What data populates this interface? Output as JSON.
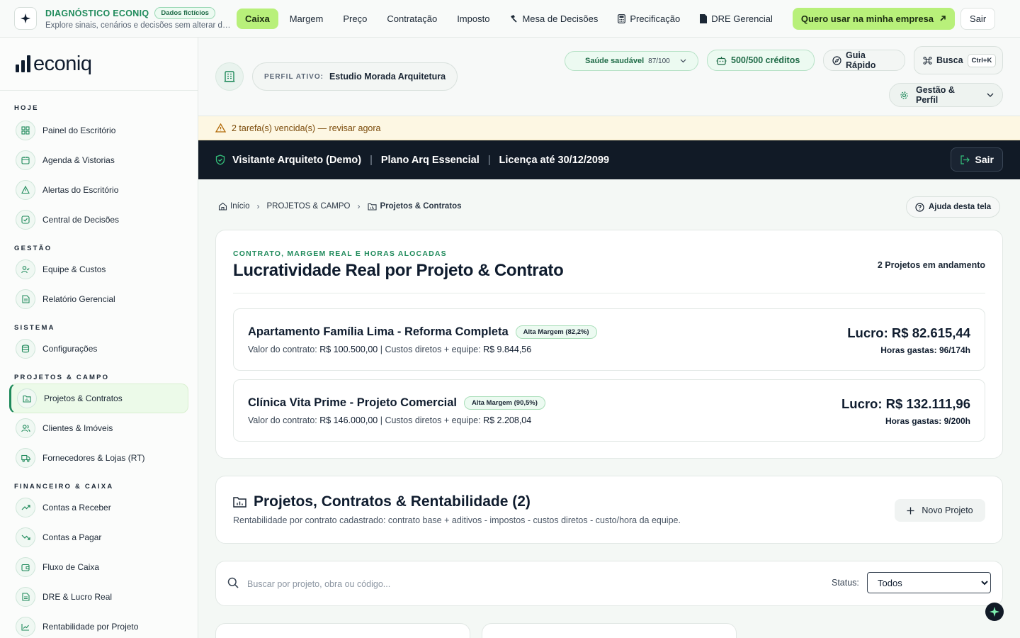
{
  "topbar": {
    "title": "DIAGNÓSTICO ECONIQ",
    "badge": "Dados fictícios",
    "subtitle": "Explore sinais, cenários e decisões sem alterar da...",
    "nav": [
      {
        "label": "Caixa",
        "active": true
      },
      {
        "label": "Margem"
      },
      {
        "label": "Preço"
      },
      {
        "label": "Contratação"
      },
      {
        "label": "Imposto"
      },
      {
        "label": "Mesa de Decisões",
        "icon": "gavel-icon"
      },
      {
        "label": "Precificação",
        "icon": "calculator-icon"
      },
      {
        "label": "DRE Gerencial",
        "icon": "file-icon"
      }
    ],
    "cta": "Quero usar na minha empresa",
    "exit": "Sair"
  },
  "sidebar": {
    "brand": "econiq",
    "sections": [
      {
        "title": "HOJE",
        "items": [
          "Painel do Escritório",
          "Agenda & Vistorias",
          "Alertas do Escritório",
          "Central de Decisões"
        ]
      },
      {
        "title": "GESTÃO",
        "items": [
          "Equipe & Custos",
          "Relatório Gerencial"
        ]
      },
      {
        "title": "SISTEMA",
        "items": [
          "Configurações"
        ]
      },
      {
        "title": "PROJETOS & CAMPO",
        "items": [
          "Projetos & Contratos",
          "Clientes & Imóveis",
          "Fornecedores & Lojas (RT)"
        ]
      },
      {
        "title": "FINANCEIRO & CAIXA",
        "items": [
          "Contas a Receber",
          "Contas a Pagar",
          "Fluxo de Caixa",
          "DRE & Lucro Real",
          "Rentabilidade por Projeto"
        ]
      }
    ],
    "active_item": "Projetos & Contratos"
  },
  "header": {
    "perfil_label": "PERFIL ATIVO:",
    "perfil_value": "Estudio Morada Arquitetura",
    "saude_label": "Saúde saudável",
    "saude_score": "87/100",
    "creditos": "500/500 créditos",
    "guia": "Guia Rápido",
    "busca": "Busca",
    "busca_kbd": "Ctrl+K",
    "gestao": "Gestão & Perfil"
  },
  "alert": {
    "text": "2 tarefa(s) vencida(s) — revisar agora"
  },
  "visitor": {
    "name": "Visitante Arquiteto (Demo)",
    "plan": "Plano Arq Essencial",
    "license": "Licença até 30/12/2099",
    "exit": "Sair"
  },
  "breadcrumb": {
    "home": "Início",
    "section": "PROJETOS & CAMPO",
    "current": "Projetos & Contratos",
    "help": "Ajuda desta tela"
  },
  "lucratividade": {
    "kicker": "CONTRATO, MARGEM REAL E HORAS ALOCADAS",
    "title": "Lucratividade Real por Projeto & Contrato",
    "count": "2 Projetos em andamento",
    "projects": [
      {
        "name": "Apartamento Família Lima - Reforma Completa",
        "tag": "Alta Margem (82,2%)",
        "valor_label": "Valor do contrato:",
        "valor": "R$ 100.500,00",
        "custos_label": "| Custos diretos + equipe:",
        "custos": "R$ 9.844,56",
        "lucro": "Lucro: R$ 82.615,44",
        "horas": "Horas gastas: 96/174h"
      },
      {
        "name": "Clínica Vita Prime - Projeto Comercial",
        "tag": "Alta Margem (90,5%)",
        "valor_label": "Valor do contrato:",
        "valor": "R$ 146.000,00",
        "custos_label": "| Custos diretos + equipe:",
        "custos": "R$ 2.208,04",
        "lucro": "Lucro: R$ 132.111,96",
        "horas": "Horas gastas: 9/200h"
      }
    ]
  },
  "rentabilidade": {
    "title": "Projetos, Contratos & Rentabilidade (2)",
    "subtitle": "Rentabilidade por contrato cadastrado: contrato base + aditivos - impostos - custos diretos - custo/hora da equipe.",
    "new_button": "Novo Projeto"
  },
  "search": {
    "placeholder": "Buscar por projeto, obra ou código...",
    "status_label": "Status:",
    "status_value": "Todos"
  },
  "colors": {
    "accent": "#b8f07a",
    "brand_green": "#1f8a5b",
    "dark": "#111a26"
  }
}
